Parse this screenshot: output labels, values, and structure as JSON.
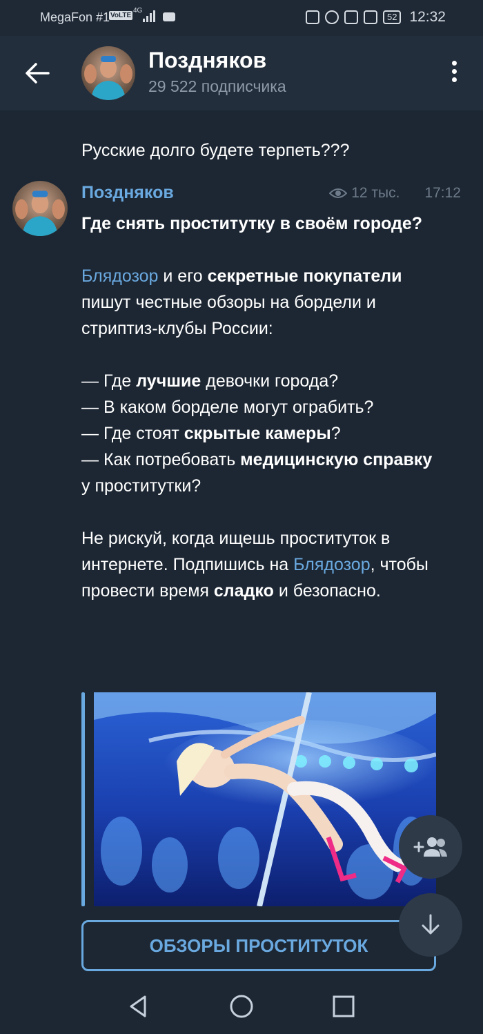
{
  "status_bar": {
    "carrier": "MegaFon #1",
    "volte": "VoLTE",
    "network": "4G",
    "battery": "52",
    "time": "12:32"
  },
  "header": {
    "channel_name": "Поздняков",
    "subscribers": "29 522 подписчика"
  },
  "previous_message": {
    "text": "Русские долго будете терпеть???"
  },
  "post": {
    "author": "Поздняков",
    "views": "12 тыс.",
    "time": "17:12",
    "title": "Где снять проститутку в своём городе?",
    "p1_link": "Блядозор",
    "p1_t1": " и его ",
    "p1_b1": "секретные покупатели",
    "p1_t2": " пишут честные обзоры на бордели и стриптиз-клубы России:",
    "l1_t1": "— Где ",
    "l1_b1": "лучшие",
    "l1_t2": " девочки города?",
    "l2_t1": "— В каком борделе могут ограбить?",
    "l3_t1": "— Где стоят ",
    "l3_b1": "скрытые камеры",
    "l3_t2": "?",
    "l4_t1": "— Как потребовать ",
    "l4_b1": "медицинскую справку",
    "l4_t2": " у проститутки?",
    "p3_t1": "Не рискуй, когда ищешь проституток в интернете. Подпишись на ",
    "p3_link": "Блядозор",
    "p3_t2": ", чтобы провести время ",
    "p3_b1": "сладко",
    "p3_t3": " и безопасно.",
    "button_label": "ОБЗОРЫ ПРОСТИТУТОК"
  },
  "colors": {
    "background": "#1d2733",
    "header": "#232e3c",
    "accent": "#6aa9e0",
    "muted": "#8e9aa8"
  },
  "icons": {
    "back": "arrow-left-icon",
    "menu": "more-vertical-icon",
    "views": "eye-icon",
    "add_members": "add-user-icon",
    "scroll_down": "arrow-down-icon"
  }
}
